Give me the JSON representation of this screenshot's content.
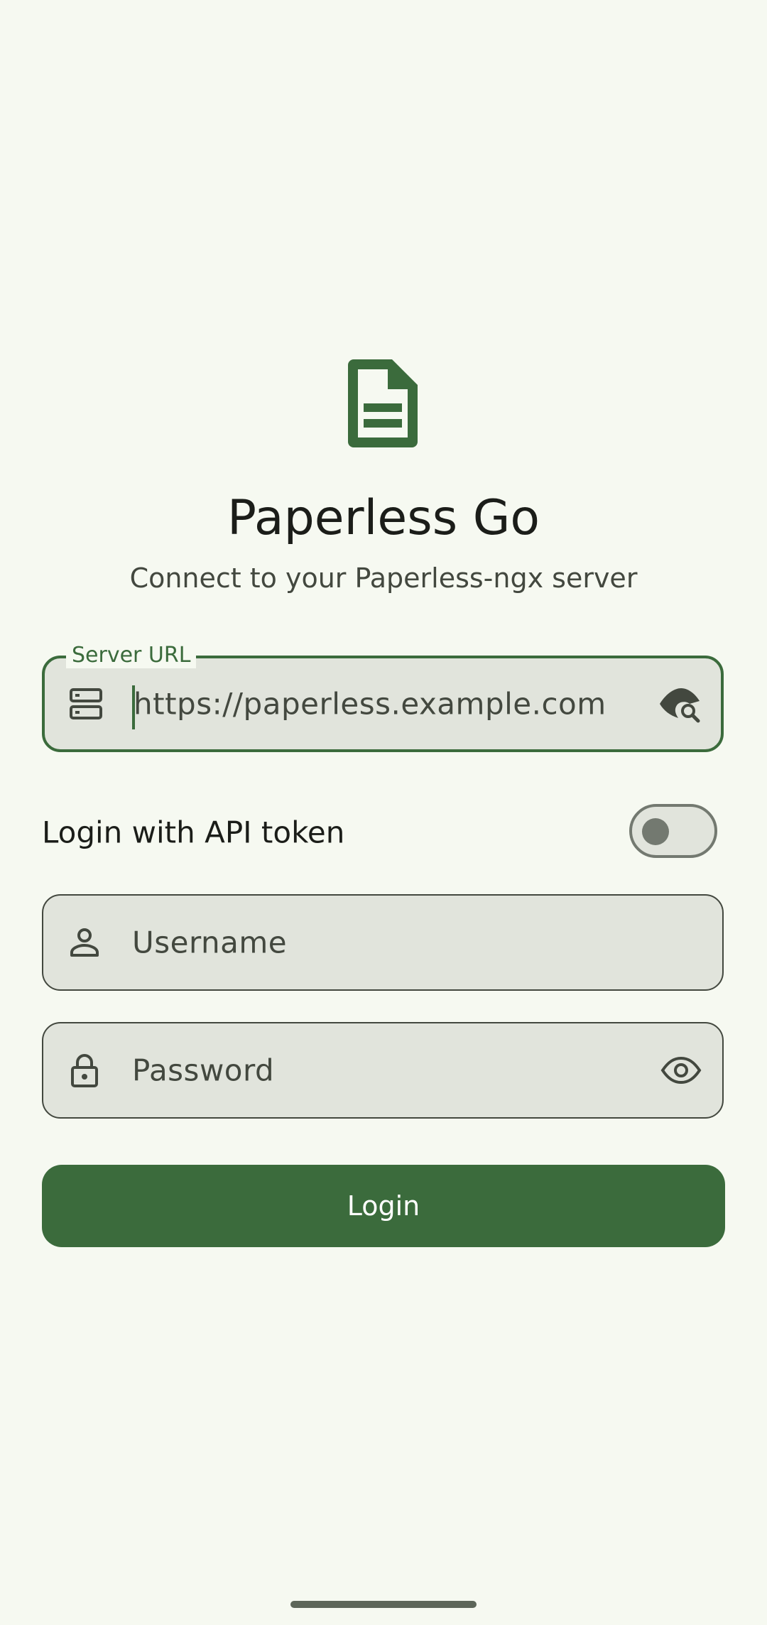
{
  "app": {
    "title": "Paperless Go",
    "subtitle": "Connect to your Paperless-ngx server",
    "logo_icon": "document-icon",
    "accent_color": "#3b6b3c"
  },
  "server_url": {
    "label": "Server URL",
    "placeholder": "https://paperless.example.com",
    "value": "",
    "leading_icon": "server-icon",
    "trailing_icon": "eye-search-icon",
    "focused": true
  },
  "api_token_toggle": {
    "label": "Login with API token",
    "checked": false
  },
  "username": {
    "placeholder": "Username",
    "leading_icon": "person-icon"
  },
  "password": {
    "placeholder": "Password",
    "leading_icon": "lock-icon",
    "trailing_icon": "eye-icon"
  },
  "login_button": {
    "label": "Login"
  }
}
